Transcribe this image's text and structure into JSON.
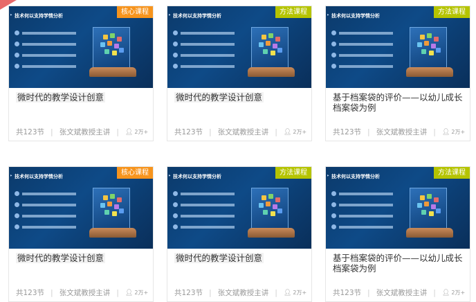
{
  "thumbnail_title": "技术何以支持学情分析",
  "icons": {
    "learners": "person-icon",
    "bullet": "dot-icon"
  },
  "colors": {
    "core_badge": "#f7941d",
    "method_badge": "#b5c400"
  },
  "courses": [
    {
      "badge": "核心课程",
      "badge_type": "core",
      "title": "微时代的教学设计创意",
      "lessons": "共123节",
      "teacher": "张文斌教授主讲",
      "learners": "2万+"
    },
    {
      "badge": "方法课程",
      "badge_type": "method",
      "title": "微时代的教学设计创意",
      "lessons": "共123节",
      "teacher": "张文斌教授主讲",
      "learners": "2万+"
    },
    {
      "badge": "方法课程",
      "badge_type": "method",
      "title": "基于档案袋的评价——以幼儿成长档案袋为例",
      "lessons": "共123节",
      "teacher": "张文斌教授主讲",
      "learners": "2万+"
    },
    {
      "badge": "核心课程",
      "badge_type": "core",
      "title": "微时代的教学设计创意",
      "lessons": "共123节",
      "teacher": "张文斌教授主讲",
      "learners": "2万+"
    },
    {
      "badge": "方法课程",
      "badge_type": "method",
      "title": "微时代的教学设计创意",
      "lessons": "共123节",
      "teacher": "张文斌教授主讲",
      "learners": "2万+"
    },
    {
      "badge": "方法课程",
      "badge_type": "method",
      "title": "基于档案袋的评价——以幼儿成长档案袋为例",
      "lessons": "共123节",
      "teacher": "张文斌教授主讲",
      "learners": "2万+"
    }
  ]
}
